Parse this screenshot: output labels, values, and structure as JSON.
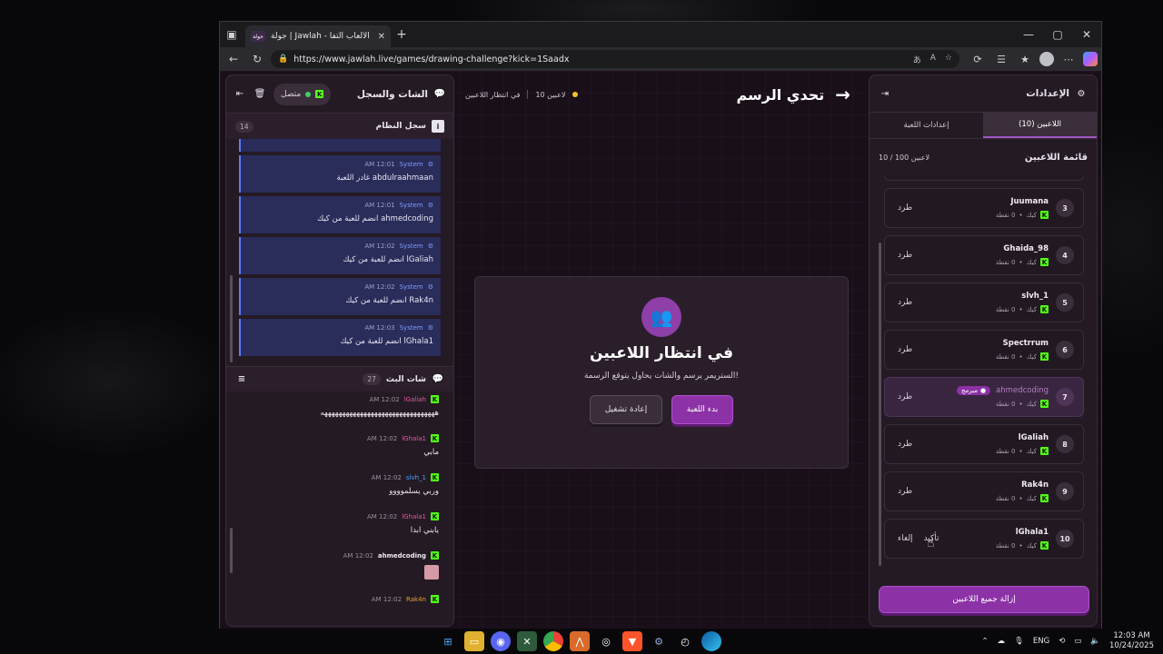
{
  "browser": {
    "tab_title": "جولة | Jawlah - منصة الألعاب التفا...",
    "tab_favicon": "جولة",
    "url": "https://www.jawlah.live/games/drawing-challenge?kick=1Saadx"
  },
  "chat": {
    "title": "الشات والسجل",
    "status": "متصل",
    "syslog_title": "سجل النظام",
    "syslog_count": "14",
    "logs": [
      {
        "sender": "System",
        "time": "12:01 AM",
        "text": "abdulraahmaan غادر اللعبة"
      },
      {
        "sender": "System",
        "time": "12:01 AM",
        "text": "ahmedcoding انضم للعبة من كيك"
      },
      {
        "sender": "System",
        "time": "12:02 AM",
        "text": "lGaliah انضم للعبة من كيك"
      },
      {
        "sender": "System",
        "time": "12:02 AM",
        "text": "Rak4n انضم للعبة من كيك"
      },
      {
        "sender": "System",
        "time": "12:03 AM",
        "text": "lGhala1 انضم للعبة من كيك"
      }
    ],
    "live_title": "شات البث",
    "live_count": "27",
    "messages": [
      {
        "user": "lGaliah",
        "color": "#e05aa0",
        "time": "12:02 AM",
        "text": "ههههههههههههههههههههههههههههههههه"
      },
      {
        "user": "lGhala1",
        "color": "#e05aa0",
        "time": "12:02 AM",
        "text": "مابي"
      },
      {
        "user": "slvh_1",
        "color": "#4aa0ff",
        "time": "12:02 AM",
        "text": "وربي يسلموووو"
      },
      {
        "user": "lGhala1",
        "color": "#e05aa0",
        "time": "12:02 AM",
        "text": "يابني ابدا"
      },
      {
        "user": "ahmedcoding",
        "color": "#f0ebf2",
        "time": "12:02 AM",
        "text": ""
      },
      {
        "user": "Rak4n",
        "color": "#e8a030",
        "time": "12:02 AM",
        "text": ""
      }
    ]
  },
  "game": {
    "status": "في انتظار اللاعبين",
    "player_count": "10 لاعبين",
    "title": "تحدي الرسم",
    "waiting_title": "في انتظار اللاعبين",
    "waiting_sub": "الستريمر يرسم والشات يحاول يتوقع الرسمة!",
    "start_button": "بدء اللعبة",
    "restart_button": "إعادة تشغيل"
  },
  "settings": {
    "title": "الإعدادات",
    "tab_players": "اللاعبين (10)",
    "tab_game": "إعدادات اللعبة",
    "list_title": "قائمة اللاعبين",
    "list_count": "10 / 100 لاعبين",
    "players": [
      {
        "num": "3",
        "name": "Juumana",
        "points": "0 نقطة",
        "source": "كيك",
        "action": "طرد"
      },
      {
        "num": "4",
        "name": "Ghaida_98",
        "points": "0 نقطة",
        "source": "كيك",
        "action": "طرد"
      },
      {
        "num": "5",
        "name": "slvh_1",
        "points": "0 نقطة",
        "source": "كيك",
        "action": "طرد"
      },
      {
        "num": "6",
        "name": "Spectrrum",
        "points": "0 نقطة",
        "source": "كيك",
        "action": "طرد"
      },
      {
        "num": "7",
        "name": "ahmedcoding",
        "points": "0 نقطة",
        "source": "كيك",
        "action": "طرد",
        "badge": "مبرمج"
      },
      {
        "num": "8",
        "name": "lGaliah",
        "points": "0 نقطة",
        "source": "كيك",
        "action": "طرد"
      },
      {
        "num": "9",
        "name": "Rak4n",
        "points": "0 نقطة",
        "source": "كيك",
        "action": "طرد"
      },
      {
        "num": "10",
        "name": "lGhala1",
        "points": "0 نقطة",
        "source": "كيك",
        "confirm": "تأكيد",
        "cancel": "إلغاء"
      }
    ],
    "remove_all": "إزالة جميع اللاعبين"
  },
  "taskbar": {
    "lang": "ENG",
    "time": "12:03 AM",
    "date": "10/24/2025"
  }
}
